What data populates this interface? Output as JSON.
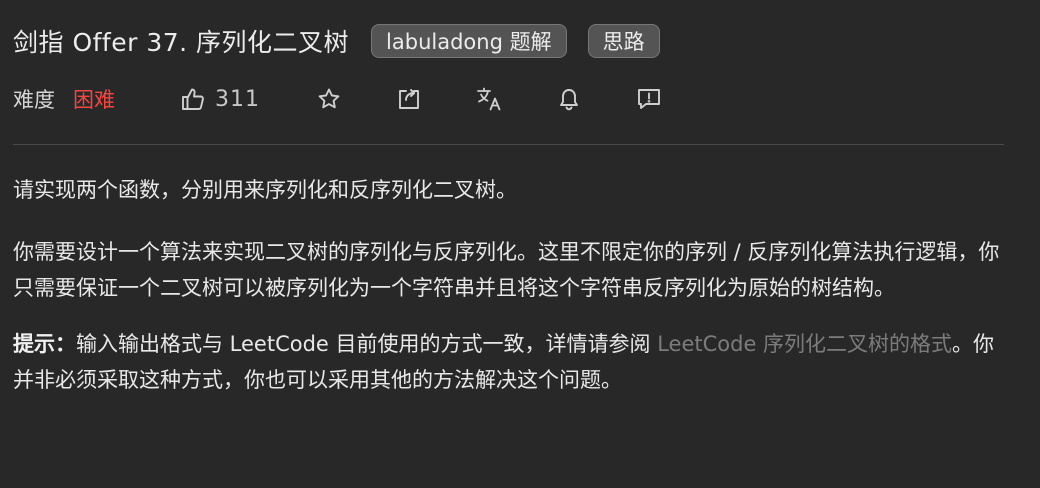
{
  "problem": {
    "title": "剑指 Offer 37. 序列化二叉树",
    "tags": [
      "labuladong 题解",
      "思路"
    ],
    "difficulty_label": "难度",
    "difficulty": "困难",
    "likes": "311"
  },
  "icons": {
    "like": "thumbs-up-icon",
    "favorite": "star-icon",
    "share": "share-icon",
    "translate": "translate-icon",
    "notify": "bell-icon",
    "feedback": "feedback-icon"
  },
  "colors": {
    "background": "#282828",
    "difficulty_hard": "#ef4743",
    "link": "#7c7c7c",
    "tag_bg": "#545454"
  },
  "description": {
    "p1": "请实现两个函数，分别用来序列化和反序列化二叉树。",
    "p2": "你需要设计一个算法来实现二叉树的序列化与反序列化。这里不限定你的序列 / 反序列化算法执行逻辑，你只需要保证一个二叉树可以被序列化为一个字符串并且将这个字符串反序列化为原始的树结构。",
    "hint_label": "提示：",
    "hint_before": "输入输出格式与 LeetCode 目前使用的方式一致，详情请参阅 ",
    "hint_link": "LeetCode 序列化二叉树的格式",
    "hint_after": "。你并非必须采取这种方式，你也可以采用其他的方法解决这个问题。"
  }
}
